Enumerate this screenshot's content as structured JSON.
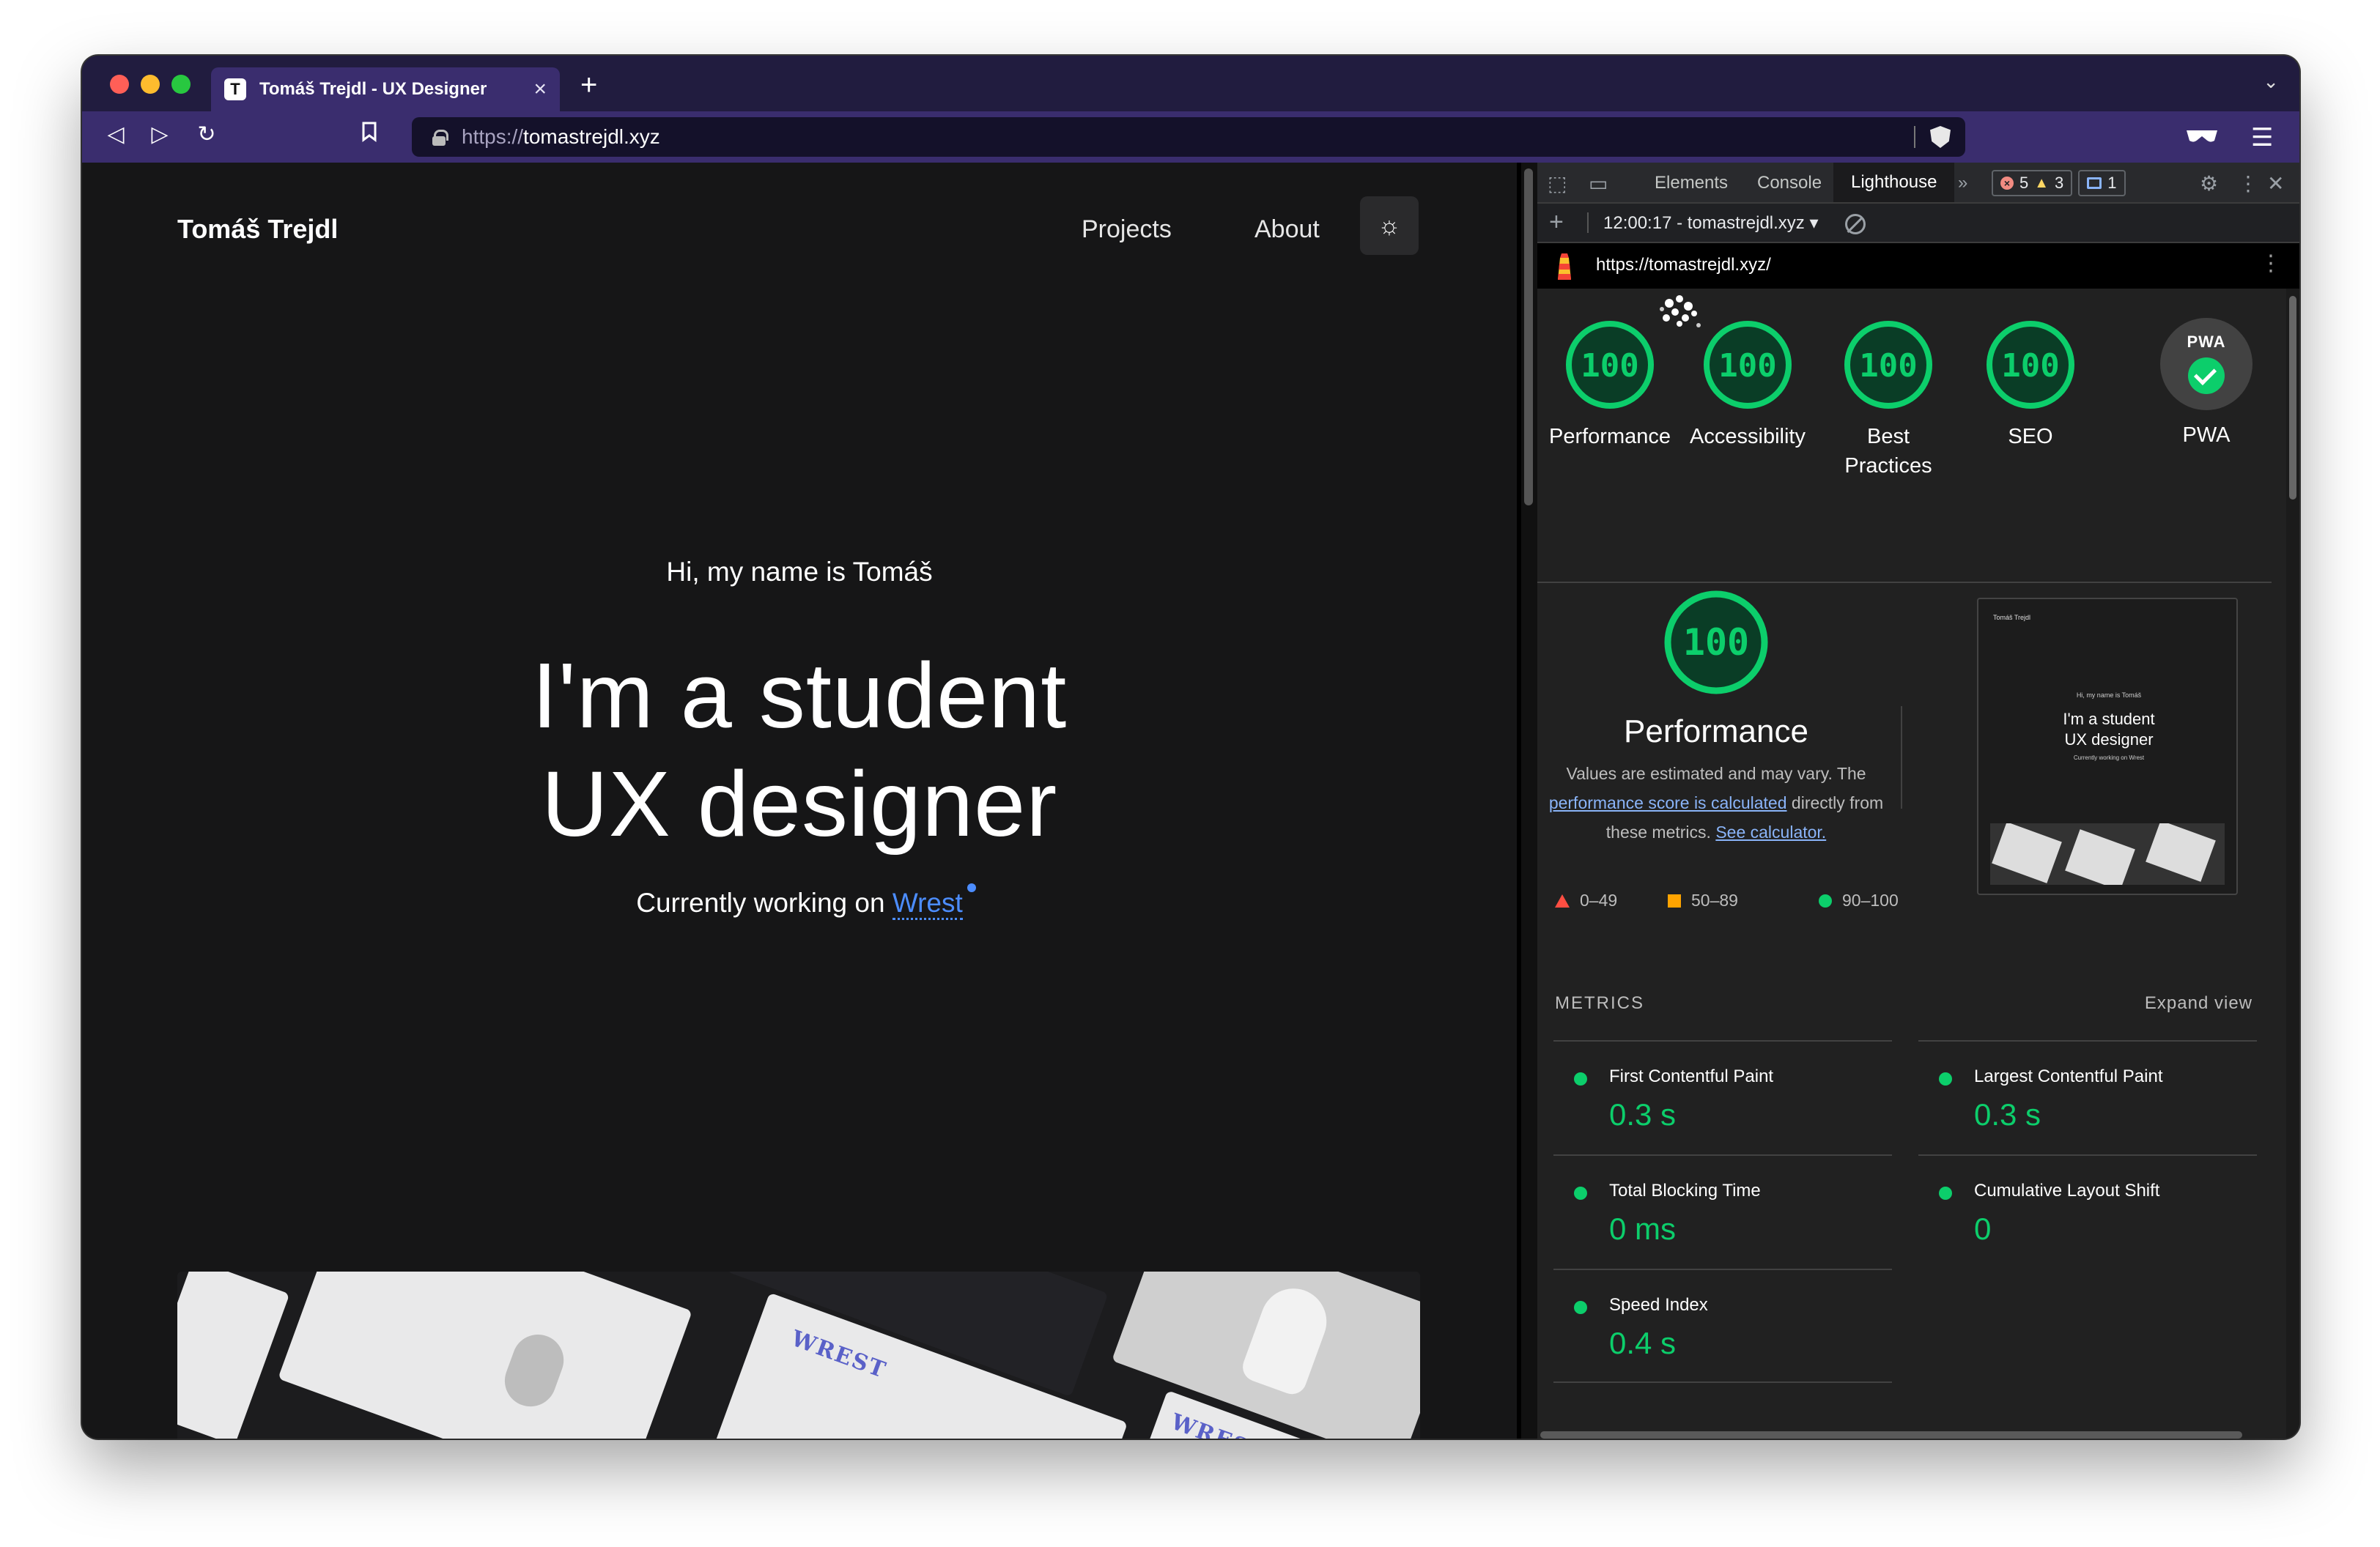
{
  "browser": {
    "tab_title": "Tomáš Trejdl - UX Designer",
    "tab_favicon": "T",
    "url_protocol": "https://",
    "url_host": "tomastrejdl.xyz"
  },
  "site": {
    "logo": "Tomáš Trejdl",
    "nav": [
      "Projects",
      "About"
    ],
    "hero_greeting": "Hi, my name is Tomáš",
    "hero_title_line1": "I'm a student",
    "hero_title_line2": "UX designer",
    "hero_work_prefix": "Currently working on ",
    "hero_work_link": "Wrest",
    "gallery_brand": "WREST"
  },
  "devtools": {
    "tabs": [
      "Elements",
      "Console",
      "Lighthouse"
    ],
    "active_tab": "Lighthouse",
    "errors": "5",
    "warnings": "3",
    "messages": "1",
    "report_run": "12:00:17 - tomastrejdl.xyz",
    "report_url": "https://tomastrejdl.xyz/"
  },
  "lighthouse": {
    "scores": [
      {
        "label": "Performance",
        "value": "100"
      },
      {
        "label": "Accessibility",
        "value": "100"
      },
      {
        "label": "Best Practices",
        "value": "100"
      },
      {
        "label": "SEO",
        "value": "100"
      }
    ],
    "pwa": {
      "badge": "PWA",
      "label": "PWA"
    },
    "performance": {
      "score": "100",
      "title": "Performance",
      "desc_1": "Values are estimated and may vary. The ",
      "desc_link1": "performance score is calculated",
      "desc_2": " directly from these metrics. ",
      "desc_link2": "See calculator."
    },
    "legend": [
      "0–49",
      "50–89",
      "90–100"
    ],
    "thumbnail": {
      "logo": "Tomáš Trejdl",
      "greeting": "Hi, my name is Tomáš",
      "title_line1": "I'm a student",
      "title_line2": "UX designer",
      "work": "Currently working on Wrest"
    },
    "metrics_heading": "METRICS",
    "expand_view": "Expand view",
    "metrics": [
      {
        "label": "First Contentful Paint",
        "value": "0.3 s"
      },
      {
        "label": "Largest Contentful Paint",
        "value": "0.3 s"
      },
      {
        "label": "Total Blocking Time",
        "value": "0 ms"
      },
      {
        "label": "Cumulative Layout Shift",
        "value": "0"
      },
      {
        "label": "Speed Index",
        "value": "0.4 s"
      }
    ]
  },
  "colors": {
    "accent_link": "#4c8dff",
    "score_pass": "#0cce6b",
    "score_average": "#ffa400",
    "score_fail": "#ff4e42",
    "tabbar": "#211c3f",
    "toolbar": "#3a2d6e"
  },
  "icons": {
    "back": "back-icon",
    "forward": "forward-icon",
    "reload": "reload-icon",
    "bookmark": "bookmark-icon",
    "lock": "lock-icon",
    "brave_shield": "shield-icon",
    "theme": "sun-icon"
  }
}
